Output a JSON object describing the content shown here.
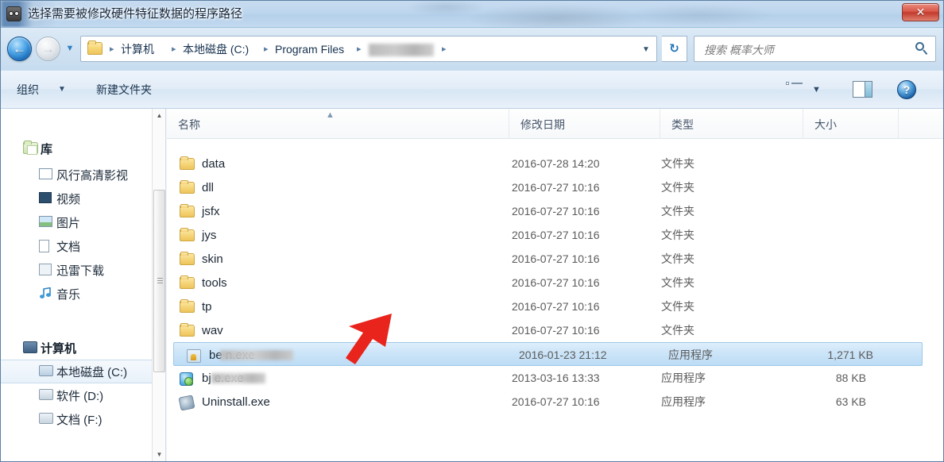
{
  "window": {
    "title": "选择需要被修改硬件特征数据的程序路径",
    "app_icon": "robot-face-icon",
    "close_label": "✕"
  },
  "nav": {
    "back_glyph": "←",
    "forward_glyph": "→",
    "recent_caret": "▼",
    "address_dropdown": "▼",
    "refresh_glyph": "↻",
    "breadcrumbs": [
      {
        "label": "计算机",
        "redacted": false
      },
      {
        "label": "本地磁盘 (C:)",
        "redacted": false
      },
      {
        "label": "Program Files",
        "redacted": false
      },
      {
        "label": "",
        "redacted": true
      }
    ],
    "separator": "▸"
  },
  "search": {
    "placeholder": "搜索 概率大师",
    "icon": "search-icon"
  },
  "toolbar": {
    "organize_label": "组织",
    "organize_caret": "▼",
    "new_folder_label": "新建文件夹",
    "view_caret": "▼",
    "help_glyph": "?",
    "icons": [
      "view-options-icon",
      "preview-pane-icon",
      "help-icon"
    ]
  },
  "sidebar": {
    "items": [
      {
        "label": "库",
        "icon": "library-icon",
        "level": 0,
        "selected": false
      },
      {
        "label": "风行高清影视",
        "icon": "media-icon",
        "level": 1,
        "selected": false
      },
      {
        "label": "视频",
        "icon": "video-icon",
        "level": 1,
        "selected": false
      },
      {
        "label": "图片",
        "icon": "pictures-icon",
        "level": 1,
        "selected": false
      },
      {
        "label": "文档",
        "icon": "documents-icon",
        "level": 1,
        "selected": false
      },
      {
        "label": "迅雷下载",
        "icon": "downloads-icon",
        "level": 1,
        "selected": false
      },
      {
        "label": "音乐",
        "icon": "music-icon",
        "level": 1,
        "selected": false
      },
      {
        "label": "计算机",
        "icon": "computer-icon",
        "level": 0,
        "selected": false
      },
      {
        "label": "本地磁盘 (C:)",
        "icon": "system-drive-icon",
        "level": 1,
        "selected": true
      },
      {
        "label": "软件 (D:)",
        "icon": "drive-icon",
        "level": 1,
        "selected": false
      },
      {
        "label": "文档 (F:)",
        "icon": "drive-icon",
        "level": 1,
        "selected": false
      }
    ],
    "scrollbar": {
      "up": "▲",
      "down": "▼"
    }
  },
  "filelist": {
    "columns": [
      {
        "label": "名称"
      },
      {
        "label": "修改日期"
      },
      {
        "label": "类型"
      },
      {
        "label": "大小"
      }
    ],
    "sort_indicator": "▲",
    "rows": [
      {
        "name": "data",
        "date": "2016-07-28 14:20",
        "type": "文件夹",
        "size": "",
        "icon": "folder-icon",
        "selected": false,
        "redacted": false
      },
      {
        "name": "dll",
        "date": "2016-07-27 10:16",
        "type": "文件夹",
        "size": "",
        "icon": "folder-icon",
        "selected": false,
        "redacted": false
      },
      {
        "name": "jsfx",
        "date": "2016-07-27 10:16",
        "type": "文件夹",
        "size": "",
        "icon": "folder-icon",
        "selected": false,
        "redacted": false
      },
      {
        "name": "jys",
        "date": "2016-07-27 10:16",
        "type": "文件夹",
        "size": "",
        "icon": "folder-icon",
        "selected": false,
        "redacted": false
      },
      {
        "name": "skin",
        "date": "2016-07-27 10:16",
        "type": "文件夹",
        "size": "",
        "icon": "folder-icon",
        "selected": false,
        "redacted": false
      },
      {
        "name": "tools",
        "date": "2016-07-27 10:16",
        "type": "文件夹",
        "size": "",
        "icon": "folder-icon",
        "selected": false,
        "redacted": false
      },
      {
        "name": "tp",
        "date": "2016-07-27 10:16",
        "type": "文件夹",
        "size": "",
        "icon": "folder-icon",
        "selected": false,
        "redacted": false
      },
      {
        "name": "wav",
        "date": "2016-07-27 10:16",
        "type": "文件夹",
        "size": "",
        "icon": "folder-icon",
        "selected": false,
        "redacted": false
      },
      {
        "name": "be        n.exe",
        "date": "2016-01-23 21:12",
        "type": "应用程序",
        "size": "1,271 KB",
        "icon": "application-icon",
        "selected": true,
        "redacted": true
      },
      {
        "name": "bj       e.exe",
        "date": "2013-03-16 13:33",
        "type": "应用程序",
        "size": "88 KB",
        "icon": "installer-icon",
        "selected": false,
        "redacted": true
      },
      {
        "name": "Uninstall.exe",
        "date": "2016-07-27 10:16",
        "type": "应用程序",
        "size": "63 KB",
        "icon": "uninstall-icon",
        "selected": false,
        "redacted": false
      }
    ]
  },
  "annotation": {
    "type": "red-arrow",
    "color": "#e8241c",
    "points_at": "be        n.exe"
  }
}
